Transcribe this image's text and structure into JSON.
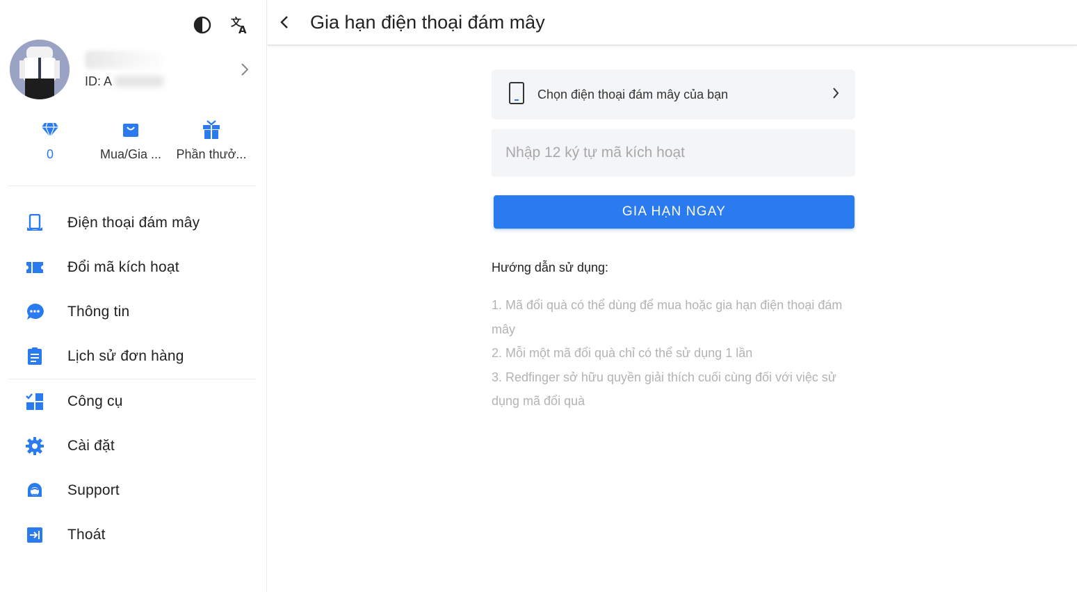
{
  "sidebar": {
    "top_icons": [
      {
        "icon": "contrast-icon"
      },
      {
        "icon": "translate-icon"
      }
    ],
    "profile": {
      "id_label": "ID: A"
    },
    "quick_actions": [
      {
        "icon": "diamond-icon",
        "label": "0"
      },
      {
        "icon": "shopping-bag-icon",
        "label": "Mua/Gia ..."
      },
      {
        "icon": "gift-icon",
        "label": "Phần thưở..."
      }
    ],
    "menu": [
      {
        "icon": "cloud-phone-icon",
        "label": "Điện thoại đám mây"
      },
      {
        "icon": "ticket-icon",
        "label": "Đổi mã kích hoạt"
      },
      {
        "icon": "message-icon",
        "label": "Thông tin"
      },
      {
        "icon": "order-history-icon",
        "label": "Lịch sử đơn hàng"
      },
      {
        "icon": "tools-icon",
        "label": "Công cụ"
      },
      {
        "icon": "settings-icon",
        "label": "Cài đặt"
      },
      {
        "icon": "support-icon",
        "label": "Support"
      },
      {
        "icon": "logout-icon",
        "label": "Thoát"
      }
    ]
  },
  "header": {
    "title": "Gia hạn điện thoại đám mây"
  },
  "form": {
    "select_phone_label": "Chọn điện thoại đám mây của bạn",
    "code_placeholder": "Nhập 12 ký tự mã kích hoạt",
    "code_value": "",
    "submit_label": "GIA HẠN NGAY"
  },
  "guide": {
    "title": "Hướng dẫn sử dụng:",
    "items": [
      "1. Mã đổi quà có thể dùng để mua hoặc gia hạn điện thoại đám mây",
      "2. Mỗi một mã đổi quà chỉ có thể sử dụng 1 lần",
      "3. Redfinger sở hữu quyền giải thích cuối cùng đối với việc sử dụng mã đổi quà"
    ]
  },
  "colors": {
    "accent": "#2a7af0",
    "muted_text": "#b3b3b3",
    "field_bg": "#f4f5f7"
  }
}
